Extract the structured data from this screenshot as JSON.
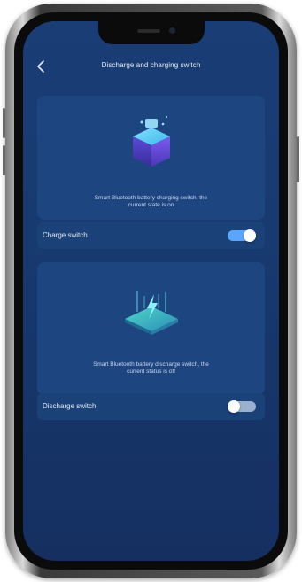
{
  "header": {
    "title": "Discharge and charging switch"
  },
  "charge_card": {
    "caption_line1": "Smart Bluetooth battery charging switch, the",
    "caption_line2": "current state is on"
  },
  "charge_row": {
    "label": "Charge switch",
    "state": "on"
  },
  "discharge_card": {
    "caption_line1": "Smart Bluetooth battery discharge switch, the",
    "caption_line2": "current status is off"
  },
  "discharge_row": {
    "label": "Discharge switch",
    "state": "off"
  },
  "colors": {
    "background": "#173a70",
    "card": "#1d4680",
    "toggle_on": "#5aa6ff",
    "toggle_off": "#9bb0cc"
  },
  "icons": {
    "back": "chevron-left-icon",
    "charge_illustration": "battery-cube-icon",
    "discharge_illustration": "lightning-platform-icon"
  }
}
